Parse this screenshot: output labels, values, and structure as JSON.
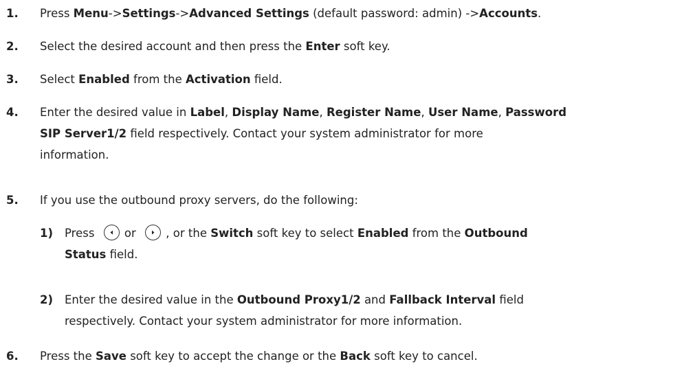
{
  "steps": [
    {
      "num": "1.",
      "t1": "Press ",
      "b1": "Menu",
      "t2": "->",
      "b2": "Settings",
      "t3": "->",
      "b3": "Advanced Settings",
      "t4": " (default password: admin) ->",
      "b4": "Accounts",
      "t5": "."
    },
    {
      "num": "2.",
      "t1": "Select the desired account and then press the ",
      "b1": "Enter",
      "t2": " soft key."
    },
    {
      "num": "3.",
      "t1": "Select ",
      "b1": "Enabled",
      "t2": " from the ",
      "b2": "Activation",
      "t3": " field."
    },
    {
      "num": "4.",
      "t1": "Enter the desired value in ",
      "b1": "Label",
      "t2": ", ",
      "b2": "Display Name",
      "t3": ", ",
      "b3": "Register Name",
      "t4": ", ",
      "b4": "User Name",
      "t5": ", ",
      "b5": "Password",
      "line2_b": "SIP Server1/2",
      "line2_t": " field respectively. Contact your system administrator for more",
      "line3": "information."
    },
    {
      "num": "5.",
      "t1": "If you use the outbound proxy servers, do the following:",
      "sub": [
        {
          "num": "1)",
          "t1": "Press ",
          "t2": " or ",
          "t3": " , or the ",
          "b1": "Switch",
          "t4": " soft key to select ",
          "b2": "Enabled",
          "t5": " from the ",
          "b3": "Outbound",
          "line2_b": "Status",
          "line2_t": " field."
        },
        {
          "num": "2)",
          "t1": "Enter the desired value in the ",
          "b1": "Outbound Proxy1/2",
          "t2": " and ",
          "b2": "Fallback Interval",
          "t3": " field",
          "line2": "respectively. Contact your system administrator for more information."
        }
      ]
    },
    {
      "num": "6.",
      "t1": "Press the ",
      "b1": "Save",
      "t2": " soft key to accept the change or the ",
      "b2": "Back",
      "t3": " soft key to cancel."
    }
  ],
  "icons": {
    "left_key": "left-arrow-key-icon",
    "right_key": "right-arrow-key-icon"
  }
}
